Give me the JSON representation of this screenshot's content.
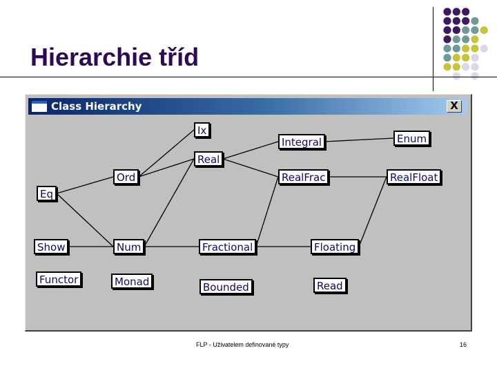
{
  "slide": {
    "title": "Hierarchie tříd",
    "footer": "FLP - Uživatelem definované typy",
    "page_number": "16"
  },
  "decoration": {
    "dot_colors": {
      "purple": "#3d1a5e",
      "teal": "#6e9a9a",
      "olive": "#c8c43a",
      "lavender": "#d8d8ea"
    },
    "dot_rows": [
      [
        "purple",
        "purple",
        "purple"
      ],
      [
        "purple",
        "purple",
        "purple",
        "teal"
      ],
      [
        "purple",
        "purple",
        "teal",
        "teal",
        "olive"
      ],
      [
        "purple",
        "teal",
        "teal",
        "olive"
      ],
      [
        "teal",
        "teal",
        "olive",
        "olive",
        "lavender"
      ],
      [
        "teal",
        "olive",
        "olive",
        "lavender"
      ],
      [
        "olive",
        "olive",
        "lavender",
        "lavender"
      ],
      [
        "",
        "lavender",
        "",
        "lavender"
      ]
    ]
  },
  "window": {
    "title": "Class Hierarchy",
    "app_icon": "window-icon",
    "close_label": "X"
  },
  "classes": [
    {
      "id": "Ix",
      "label": "Ix"
    },
    {
      "id": "Integral",
      "label": "Integral"
    },
    {
      "id": "Enum",
      "label": "Enum"
    },
    {
      "id": "Real",
      "label": "Real"
    },
    {
      "id": "Ord",
      "label": "Ord"
    },
    {
      "id": "RealFrac",
      "label": "RealFrac"
    },
    {
      "id": "RealFloat",
      "label": "RealFloat"
    },
    {
      "id": "Eq",
      "label": "Eq"
    },
    {
      "id": "Show",
      "label": "Show"
    },
    {
      "id": "Num",
      "label": "Num"
    },
    {
      "id": "Fractional",
      "label": "Fractional"
    },
    {
      "id": "Floating",
      "label": "Floating"
    },
    {
      "id": "Functor",
      "label": "Functor"
    },
    {
      "id": "Monad",
      "label": "Monad"
    },
    {
      "id": "Bounded",
      "label": "Bounded"
    },
    {
      "id": "Read",
      "label": "Read"
    }
  ],
  "edges": [
    [
      "Eq",
      "Ord"
    ],
    [
      "Eq",
      "Num"
    ],
    [
      "Show",
      "Num"
    ],
    [
      "Ord",
      "Ix"
    ],
    [
      "Ord",
      "Real"
    ],
    [
      "Num",
      "Real"
    ],
    [
      "Num",
      "Fractional"
    ],
    [
      "Real",
      "Integral"
    ],
    [
      "Real",
      "RealFrac"
    ],
    [
      "Integral",
      "Enum"
    ],
    [
      "RealFrac",
      "RealFloat"
    ],
    [
      "Fractional",
      "RealFrac"
    ],
    [
      "Fractional",
      "Floating"
    ],
    [
      "Floating",
      "RealFloat"
    ]
  ]
}
